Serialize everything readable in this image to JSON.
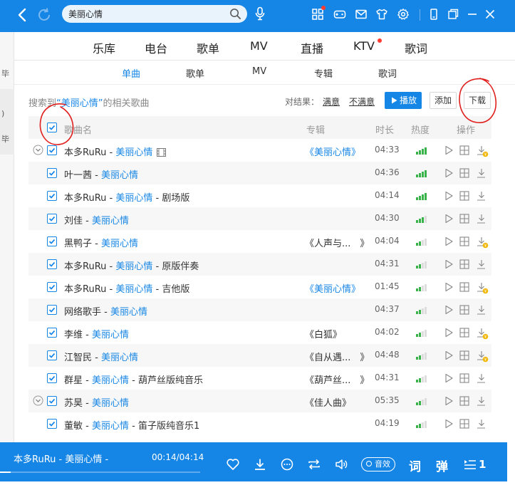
{
  "search": {
    "query": "美丽心情"
  },
  "sidebar": {
    "fragments": [
      "毕",
      ")",
      "毕"
    ]
  },
  "catnav": {
    "items": [
      "乐库",
      "电台",
      "歌单",
      "MV",
      "直播",
      "KTV",
      "歌词"
    ]
  },
  "subnav": {
    "tabs": [
      "单曲",
      "歌单",
      "MV",
      "专辑",
      "歌词"
    ],
    "active": "单曲"
  },
  "results": {
    "prefix": "搜索到",
    "keyword": "“美丽心情”",
    "suffix": "的相关歌曲",
    "feedback_label": "对结果：",
    "satisfied": "满意",
    "unsatisfied": "不满意",
    "play_all": "播放",
    "add": "添加",
    "download": "下载"
  },
  "table": {
    "headers": {
      "song": "歌曲名",
      "album": "专辑",
      "duration": "时长",
      "heat": "热度",
      "actions": "操作"
    },
    "rows": [
      {
        "artist": "本多RuRu",
        "sep": " - ",
        "title": "美丽心情",
        "suffix": "",
        "album": "《美丽心情》",
        "album_hl": true,
        "duration": "04:33",
        "heat": 4,
        "expandable": true,
        "has_mv": true,
        "vip": true
      },
      {
        "artist": "叶一茜",
        "sep": " - ",
        "title": "美丽心情",
        "suffix": "",
        "album": "",
        "album_hl": false,
        "duration": "04:36",
        "heat": 4,
        "expandable": false,
        "has_mv": false,
        "vip": false
      },
      {
        "artist": "本多RuRu",
        "sep": " - ",
        "title": "美丽心情",
        "suffix": " - 剧场版",
        "album": "",
        "album_hl": false,
        "duration": "04:14",
        "heat": 4,
        "expandable": false,
        "has_mv": false,
        "vip": false
      },
      {
        "artist": "刘佳",
        "sep": " - ",
        "title": "美丽心情",
        "suffix": "",
        "album": "",
        "album_hl": false,
        "duration": "04:30",
        "heat": 3,
        "expandable": false,
        "has_mv": false,
        "vip": false
      },
      {
        "artist": "黑鸭子",
        "sep": " - ",
        "title": "美丽心情",
        "suffix": "",
        "album": "《人声与...　》",
        "album_hl": false,
        "duration": "04:04",
        "heat": 2,
        "expandable": false,
        "has_mv": false,
        "vip": true
      },
      {
        "artist": "本多RuRu",
        "sep": " - ",
        "title": "美丽心情",
        "suffix": " - 原版伴奏",
        "album": "",
        "album_hl": false,
        "duration": "04:31",
        "heat": 2,
        "expandable": false,
        "has_mv": false,
        "vip": false
      },
      {
        "artist": "本多RuRu",
        "sep": " - ",
        "title": "美丽心情",
        "suffix": " - 吉他版",
        "album": "《美丽心情》",
        "album_hl": true,
        "duration": "01:45",
        "heat": 2,
        "expandable": false,
        "has_mv": false,
        "vip": true
      },
      {
        "artist": "网络歌手",
        "sep": " - ",
        "title": "美丽心情",
        "suffix": "",
        "album": "",
        "album_hl": false,
        "duration": "04:37",
        "heat": 2,
        "expandable": false,
        "has_mv": false,
        "vip": false
      },
      {
        "artist": "李维",
        "sep": " - ",
        "title": "美丽心情",
        "suffix": "",
        "album": "《白狐》",
        "album_hl": false,
        "duration": "04:02",
        "heat": 2,
        "expandable": false,
        "has_mv": false,
        "vip": true
      },
      {
        "artist": "江智民",
        "sep": " - ",
        "title": "美丽心情",
        "suffix": "",
        "album": "《自从遇...　》",
        "album_hl": false,
        "duration": "04:48",
        "heat": 2,
        "expandable": false,
        "has_mv": false,
        "vip": true
      },
      {
        "artist": "群星",
        "sep": " - ",
        "title": "美丽心情",
        "suffix": " - 葫芦丝版纯音乐",
        "album": "《葫芦丝...　》",
        "album_hl": false,
        "duration": "04:31",
        "heat": 2,
        "expandable": false,
        "has_mv": false,
        "vip": false
      },
      {
        "artist": "苏昊",
        "sep": " - ",
        "title": "美丽心情",
        "suffix": "",
        "album": "《佳人曲》",
        "album_hl": false,
        "duration": "05:35",
        "heat": 2,
        "expandable": true,
        "has_mv": false,
        "vip": false
      },
      {
        "artist": "董敏",
        "sep": " - ",
        "title": "美丽心情",
        "suffix": " - 笛子版纯音乐1",
        "album": "",
        "album_hl": false,
        "duration": "04:19",
        "heat": 2,
        "expandable": false,
        "has_mv": false,
        "vip": false
      }
    ]
  },
  "player": {
    "now_playing": "本多RuRu - 美丽心情 -",
    "time": "00:14/04:14",
    "progress": 0.055,
    "effect_label": "音效",
    "lyrics_label": "词",
    "danmaku_label": "弹",
    "playlist_count": "1"
  },
  "colors": {
    "brand": "#1686e6",
    "heat_on": "#37b34a",
    "annotation": "#e0201f"
  }
}
